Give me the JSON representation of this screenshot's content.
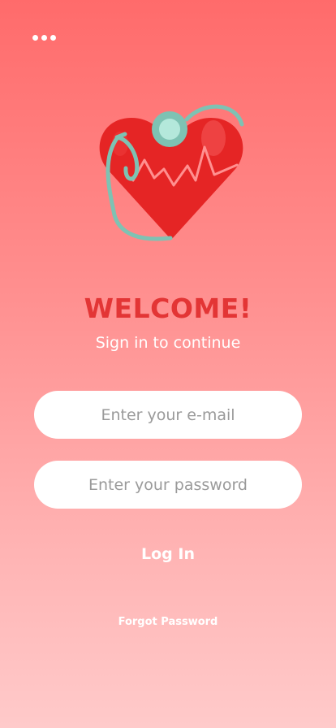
{
  "header": {
    "menu_icon": "more-horizontal-icon"
  },
  "brand": {
    "logo_icon": "heart-stethoscope-icon",
    "heart_color": "#e52525",
    "stethoscope_color": "#7ec2b3"
  },
  "welcome": {
    "title": "WELCOME!",
    "subtitle": "Sign in to continue"
  },
  "form": {
    "email": {
      "value": "",
      "placeholder": "Enter your e-mail"
    },
    "password": {
      "value": "",
      "placeholder": "Enter your password"
    },
    "login_label": "Log In",
    "forgot_label": "Forgot Password"
  },
  "colors": {
    "background_top": "#ff6b6b",
    "background_bottom": "#ffcaca",
    "title_color": "#e33535",
    "text_light": "#ffffff"
  }
}
